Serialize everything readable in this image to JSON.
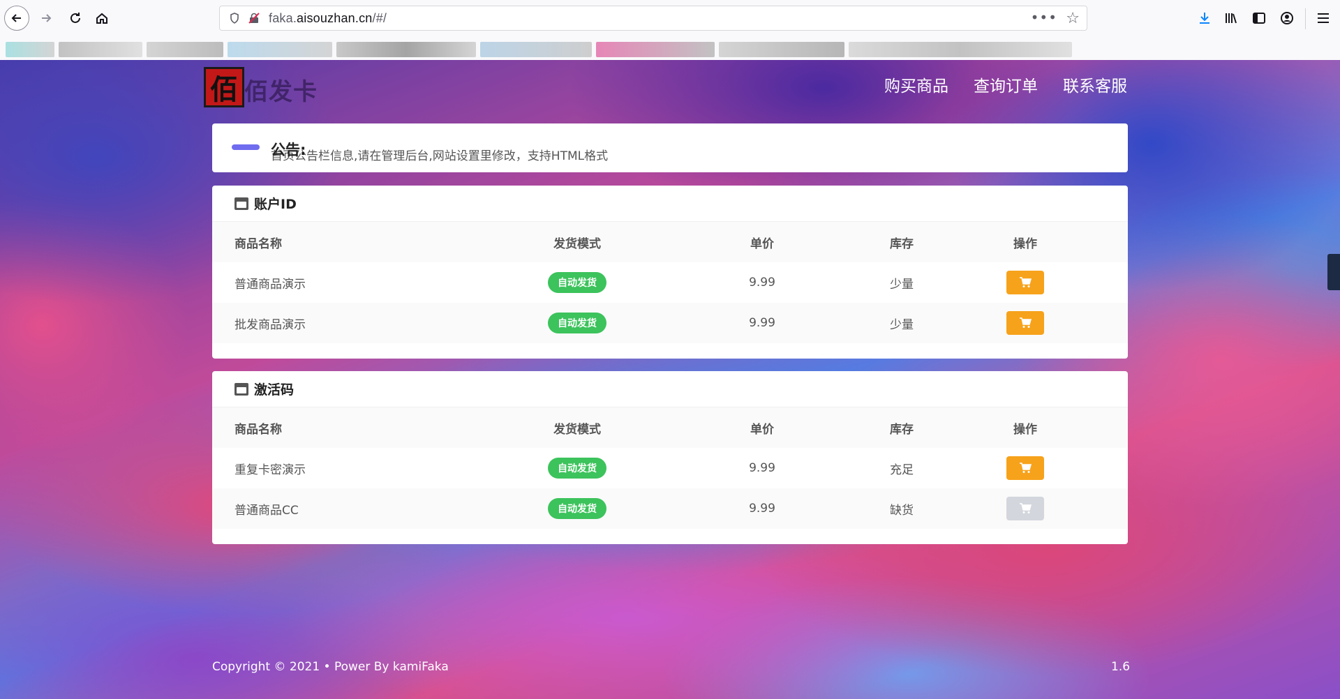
{
  "browser": {
    "url_prefix": "faka.",
    "url_host": "aisouzhan.cn",
    "url_suffix": "/#/",
    "more_label": "•••"
  },
  "site": {
    "logo_mark": "佰",
    "logo_name": "佰发卡",
    "nav": [
      {
        "label": "购买商品"
      },
      {
        "label": "查询订单"
      },
      {
        "label": "联系客服"
      }
    ]
  },
  "notice": {
    "title": "公告:",
    "text": "首页公告栏信息,请在管理后台,网站设置里修改，支持HTML格式"
  },
  "table_headers": {
    "name": "商品名称",
    "mode": "发货模式",
    "price": "单价",
    "stock": "库存",
    "op": "操作"
  },
  "categories": [
    {
      "title": "账户ID",
      "products": [
        {
          "name": "普通商品演示",
          "mode": "自动发货",
          "price": "9.99",
          "stock": "少量",
          "available": true
        },
        {
          "name": "批发商品演示",
          "mode": "自动发货",
          "price": "9.99",
          "stock": "少量",
          "available": true
        }
      ]
    },
    {
      "title": "激活码",
      "products": [
        {
          "name": "重复卡密演示",
          "mode": "自动发货",
          "price": "9.99",
          "stock": "充足",
          "available": true
        },
        {
          "name": "普通商品CC",
          "mode": "自动发货",
          "price": "9.99",
          "stock": "缺货",
          "available": false
        }
      ]
    }
  ],
  "footer": {
    "copyright": "Copyright © 2021 •  Power By kamiFaka",
    "version": "1.6"
  },
  "colors": {
    "accent": "#6f6cf0",
    "badge": "#3cc35c",
    "cart": "#f7a21b",
    "cart_disabled": "#d3d6dc"
  }
}
